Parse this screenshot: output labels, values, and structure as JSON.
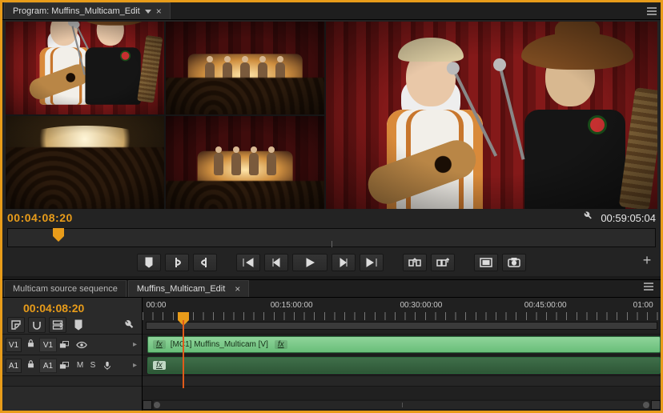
{
  "program": {
    "tab_label": "Program: Muffins_Multicam_Edit",
    "timecode_in": "00:04:08:20",
    "timecode_out": "00:59:05:04"
  },
  "multicam": {
    "selected_camera": 1,
    "camera_count": 4
  },
  "transport": {
    "mark_in_tip": "Mark In",
    "mark_out_tip": "Mark Out",
    "goto_in_tip": "Go to In",
    "step_back_tip": "Step Back",
    "play_tip": "Play",
    "step_fwd_tip": "Step Forward",
    "goto_out_tip": "Go to Out",
    "lift_tip": "Lift",
    "extract_tip": "Extract",
    "frame_tip": "Export Frame"
  },
  "timeline": {
    "tabs": {
      "source": "Multicam source sequence",
      "edit": "Muffins_Multicam_Edit"
    },
    "timecode": "00:04:08:20",
    "ruler": {
      "t0": "00:00",
      "t1": "00:15:00:00",
      "t2": "00:30:00:00",
      "t3": "00:45:00:00",
      "t4": "01:00"
    },
    "tracks": {
      "v1_src": "V1",
      "v1": "V1",
      "a1_src": "A1",
      "a1": "A1",
      "mute": "M",
      "solo": "S"
    },
    "clips": {
      "video_name": "[MC1] Muffins_Multicam [V]",
      "fx": "fx"
    }
  }
}
